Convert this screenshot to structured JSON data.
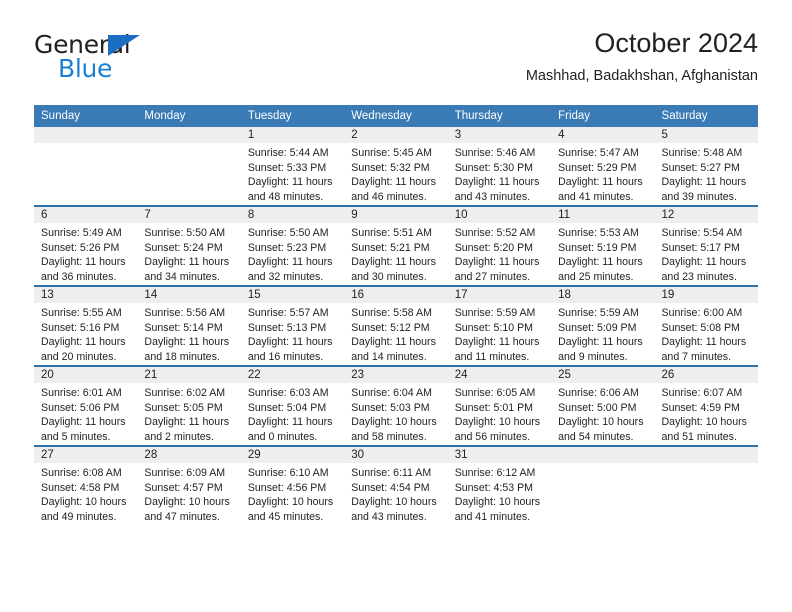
{
  "brand": {
    "word1": "General",
    "word2": "Blue",
    "triangle_color": "#1b6ec2",
    "blue_color": "#1b7fd4"
  },
  "header": {
    "title": "October 2024",
    "location": "Mashhad, Badakhshan, Afghanistan"
  },
  "theme": {
    "header_blue": "#3a7ab5",
    "row_divider_blue": "#2f72ac",
    "daynum_band_gray": "#eeeeee",
    "text": "#231f20"
  },
  "calendar": {
    "weekday_headers": [
      "Sunday",
      "Monday",
      "Tuesday",
      "Wednesday",
      "Thursday",
      "Friday",
      "Saturday"
    ],
    "weeks": [
      [
        {
          "day": "",
          "lines": []
        },
        {
          "day": "",
          "lines": []
        },
        {
          "day": "1",
          "lines": [
            "Sunrise: 5:44 AM",
            "Sunset: 5:33 PM",
            "Daylight: 11 hours",
            "and 48 minutes."
          ]
        },
        {
          "day": "2",
          "lines": [
            "Sunrise: 5:45 AM",
            "Sunset: 5:32 PM",
            "Daylight: 11 hours",
            "and 46 minutes."
          ]
        },
        {
          "day": "3",
          "lines": [
            "Sunrise: 5:46 AM",
            "Sunset: 5:30 PM",
            "Daylight: 11 hours",
            "and 43 minutes."
          ]
        },
        {
          "day": "4",
          "lines": [
            "Sunrise: 5:47 AM",
            "Sunset: 5:29 PM",
            "Daylight: 11 hours",
            "and 41 minutes."
          ]
        },
        {
          "day": "5",
          "lines": [
            "Sunrise: 5:48 AM",
            "Sunset: 5:27 PM",
            "Daylight: 11 hours",
            "and 39 minutes."
          ]
        }
      ],
      [
        {
          "day": "6",
          "lines": [
            "Sunrise: 5:49 AM",
            "Sunset: 5:26 PM",
            "Daylight: 11 hours",
            "and 36 minutes."
          ]
        },
        {
          "day": "7",
          "lines": [
            "Sunrise: 5:50 AM",
            "Sunset: 5:24 PM",
            "Daylight: 11 hours",
            "and 34 minutes."
          ]
        },
        {
          "day": "8",
          "lines": [
            "Sunrise: 5:50 AM",
            "Sunset: 5:23 PM",
            "Daylight: 11 hours",
            "and 32 minutes."
          ]
        },
        {
          "day": "9",
          "lines": [
            "Sunrise: 5:51 AM",
            "Sunset: 5:21 PM",
            "Daylight: 11 hours",
            "and 30 minutes."
          ]
        },
        {
          "day": "10",
          "lines": [
            "Sunrise: 5:52 AM",
            "Sunset: 5:20 PM",
            "Daylight: 11 hours",
            "and 27 minutes."
          ]
        },
        {
          "day": "11",
          "lines": [
            "Sunrise: 5:53 AM",
            "Sunset: 5:19 PM",
            "Daylight: 11 hours",
            "and 25 minutes."
          ]
        },
        {
          "day": "12",
          "lines": [
            "Sunrise: 5:54 AM",
            "Sunset: 5:17 PM",
            "Daylight: 11 hours",
            "and 23 minutes."
          ]
        }
      ],
      [
        {
          "day": "13",
          "lines": [
            "Sunrise: 5:55 AM",
            "Sunset: 5:16 PM",
            "Daylight: 11 hours",
            "and 20 minutes."
          ]
        },
        {
          "day": "14",
          "lines": [
            "Sunrise: 5:56 AM",
            "Sunset: 5:14 PM",
            "Daylight: 11 hours",
            "and 18 minutes."
          ]
        },
        {
          "day": "15",
          "lines": [
            "Sunrise: 5:57 AM",
            "Sunset: 5:13 PM",
            "Daylight: 11 hours",
            "and 16 minutes."
          ]
        },
        {
          "day": "16",
          "lines": [
            "Sunrise: 5:58 AM",
            "Sunset: 5:12 PM",
            "Daylight: 11 hours",
            "and 14 minutes."
          ]
        },
        {
          "day": "17",
          "lines": [
            "Sunrise: 5:59 AM",
            "Sunset: 5:10 PM",
            "Daylight: 11 hours",
            "and 11 minutes."
          ]
        },
        {
          "day": "18",
          "lines": [
            "Sunrise: 5:59 AM",
            "Sunset: 5:09 PM",
            "Daylight: 11 hours",
            "and 9 minutes."
          ]
        },
        {
          "day": "19",
          "lines": [
            "Sunrise: 6:00 AM",
            "Sunset: 5:08 PM",
            "Daylight: 11 hours",
            "and 7 minutes."
          ]
        }
      ],
      [
        {
          "day": "20",
          "lines": [
            "Sunrise: 6:01 AM",
            "Sunset: 5:06 PM",
            "Daylight: 11 hours",
            "and 5 minutes."
          ]
        },
        {
          "day": "21",
          "lines": [
            "Sunrise: 6:02 AM",
            "Sunset: 5:05 PM",
            "Daylight: 11 hours",
            "and 2 minutes."
          ]
        },
        {
          "day": "22",
          "lines": [
            "Sunrise: 6:03 AM",
            "Sunset: 5:04 PM",
            "Daylight: 11 hours",
            "and 0 minutes."
          ]
        },
        {
          "day": "23",
          "lines": [
            "Sunrise: 6:04 AM",
            "Sunset: 5:03 PM",
            "Daylight: 10 hours",
            "and 58 minutes."
          ]
        },
        {
          "day": "24",
          "lines": [
            "Sunrise: 6:05 AM",
            "Sunset: 5:01 PM",
            "Daylight: 10 hours",
            "and 56 minutes."
          ]
        },
        {
          "day": "25",
          "lines": [
            "Sunrise: 6:06 AM",
            "Sunset: 5:00 PM",
            "Daylight: 10 hours",
            "and 54 minutes."
          ]
        },
        {
          "day": "26",
          "lines": [
            "Sunrise: 6:07 AM",
            "Sunset: 4:59 PM",
            "Daylight: 10 hours",
            "and 51 minutes."
          ]
        }
      ],
      [
        {
          "day": "27",
          "lines": [
            "Sunrise: 6:08 AM",
            "Sunset: 4:58 PM",
            "Daylight: 10 hours",
            "and 49 minutes."
          ]
        },
        {
          "day": "28",
          "lines": [
            "Sunrise: 6:09 AM",
            "Sunset: 4:57 PM",
            "Daylight: 10 hours",
            "and 47 minutes."
          ]
        },
        {
          "day": "29",
          "lines": [
            "Sunrise: 6:10 AM",
            "Sunset: 4:56 PM",
            "Daylight: 10 hours",
            "and 45 minutes."
          ]
        },
        {
          "day": "30",
          "lines": [
            "Sunrise: 6:11 AM",
            "Sunset: 4:54 PM",
            "Daylight: 10 hours",
            "and 43 minutes."
          ]
        },
        {
          "day": "31",
          "lines": [
            "Sunrise: 6:12 AM",
            "Sunset: 4:53 PM",
            "Daylight: 10 hours",
            "and 41 minutes."
          ]
        },
        {
          "day": "",
          "lines": []
        },
        {
          "day": "",
          "lines": []
        }
      ]
    ]
  }
}
